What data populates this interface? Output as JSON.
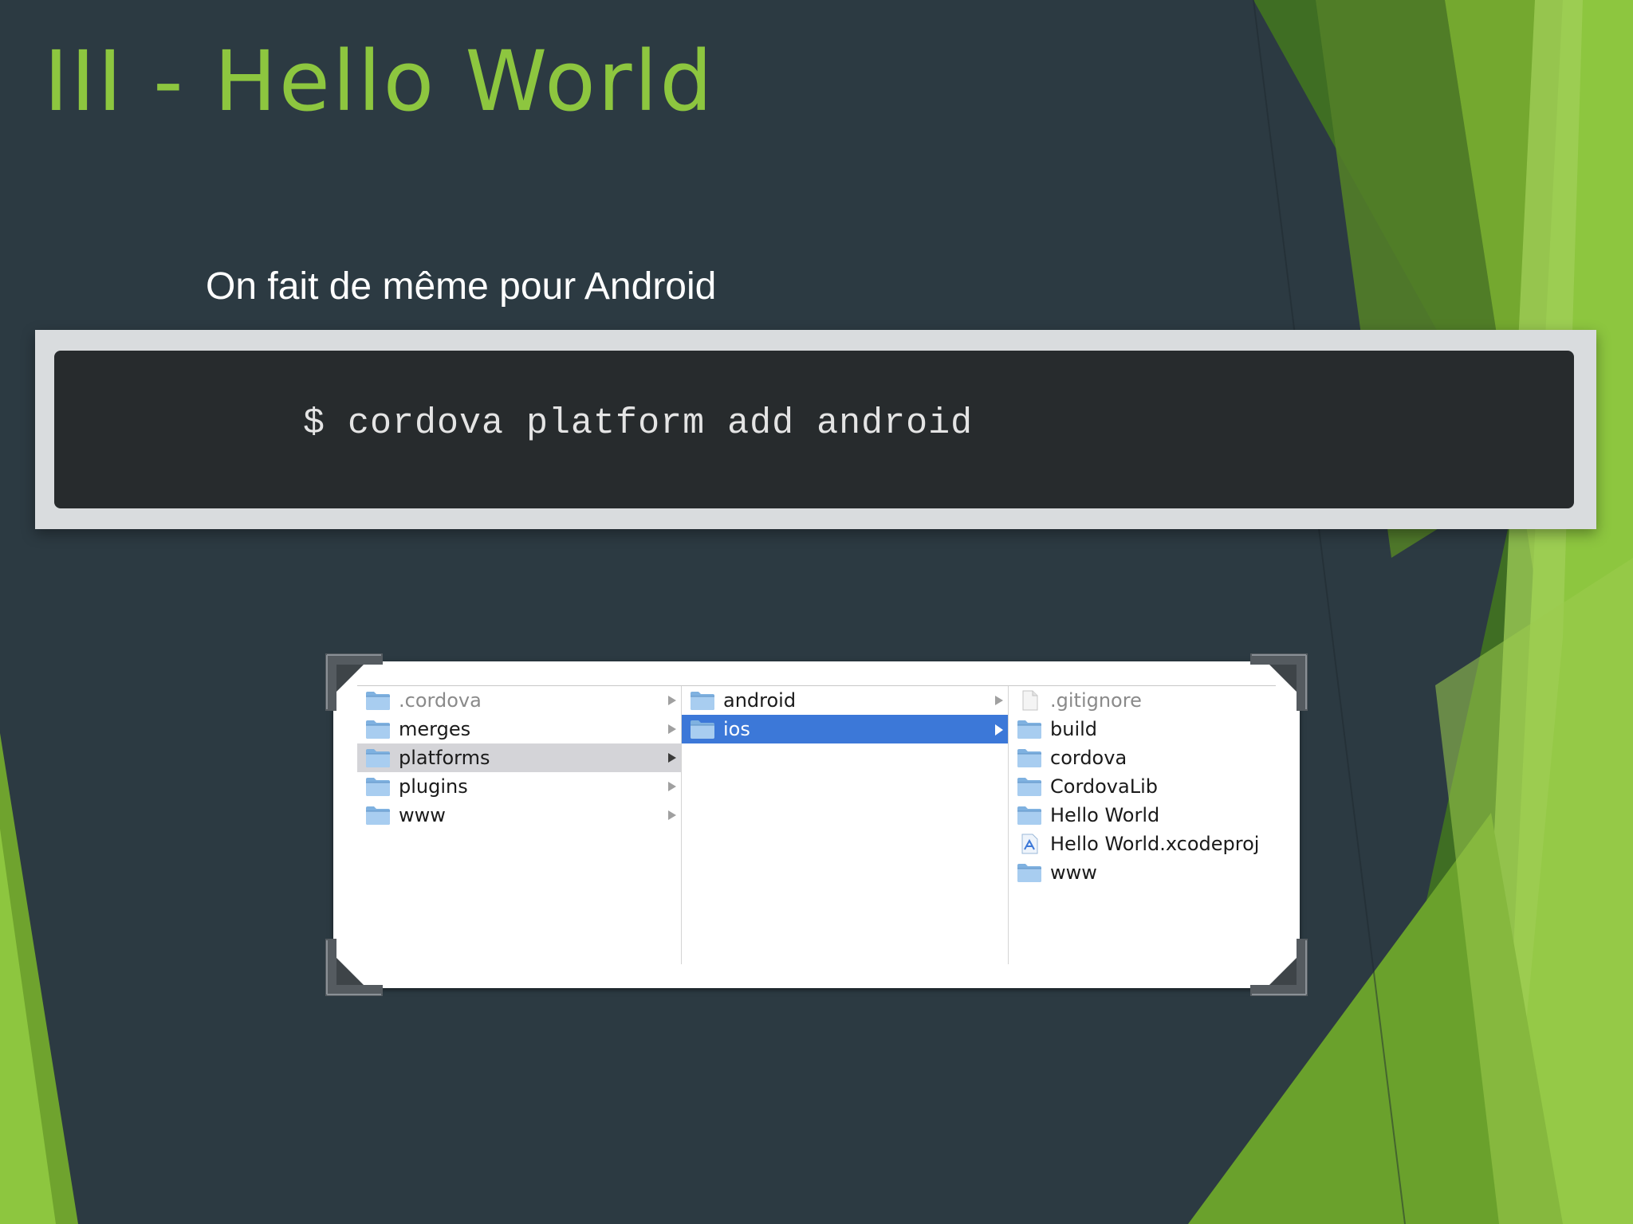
{
  "slide": {
    "title": "III - Hello World",
    "subtitle": "On fait de même pour Android",
    "command": "$ cordova platform add android",
    "colors": {
      "background": "#2c3a42",
      "accent": "#8dc63f",
      "selection": "#3c78d8"
    }
  },
  "finder": {
    "column1": [
      {
        "label": ".cordova",
        "icon": "folder-icon",
        "dim": true,
        "arrow": true
      },
      {
        "label": "merges",
        "icon": "folder-icon",
        "arrow": true
      },
      {
        "label": "platforms",
        "icon": "folder-icon",
        "arrow": true,
        "selected": "gray"
      },
      {
        "label": "plugins",
        "icon": "folder-icon",
        "arrow": true
      },
      {
        "label": "www",
        "icon": "folder-icon",
        "arrow": true
      }
    ],
    "column2": [
      {
        "label": "android",
        "icon": "folder-icon",
        "arrow": true
      },
      {
        "label": "ios",
        "icon": "folder-icon",
        "arrow": true,
        "selected": "blue"
      }
    ],
    "column3": [
      {
        "label": ".gitignore",
        "icon": "document-icon",
        "dim": true
      },
      {
        "label": "build",
        "icon": "folder-icon"
      },
      {
        "label": "cordova",
        "icon": "folder-icon"
      },
      {
        "label": "CordovaLib",
        "icon": "folder-icon"
      },
      {
        "label": "Hello World",
        "icon": "folder-icon"
      },
      {
        "label": "Hello World.xcodeproj",
        "icon": "xcodeproj-icon"
      },
      {
        "label": "www",
        "icon": "folder-icon"
      }
    ]
  }
}
